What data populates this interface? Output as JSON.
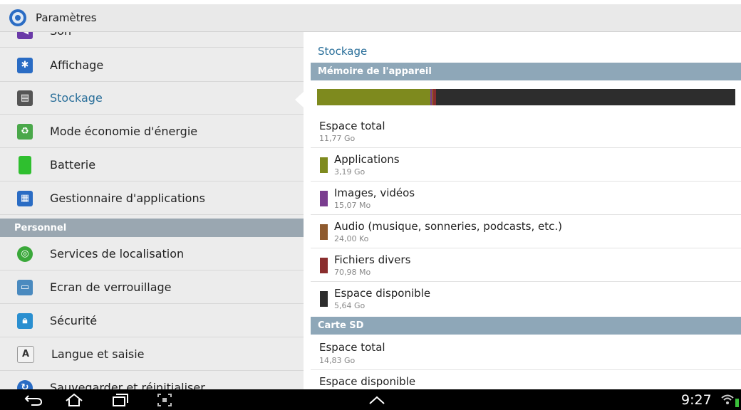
{
  "app": {
    "title": "Paramètres"
  },
  "sidebar": {
    "items_top": [
      {
        "label": "Son",
        "icon": "sound-icon",
        "color": "#6a3aa8"
      },
      {
        "label": "Affichage",
        "icon": "display-icon",
        "color": "#2a6cc4"
      },
      {
        "label": "Stockage",
        "icon": "storage-icon",
        "color": "#555555",
        "selected": true
      },
      {
        "label": "Mode économie d'énergie",
        "icon": "power-saving-icon",
        "color": "#4aa84a"
      },
      {
        "label": "Batterie",
        "icon": "battery-icon",
        "color": "#2fbf2f"
      },
      {
        "label": "Gestionnaire d'applications",
        "icon": "app-manager-icon",
        "color": "#2a6cc4"
      }
    ],
    "section_personal": "Personnel",
    "items_personal": [
      {
        "label": "Services de localisation",
        "icon": "location-icon",
        "color": "#3aa83a"
      },
      {
        "label": "Ecran de verrouillage",
        "icon": "lock-screen-icon",
        "color": "#4a8abf"
      },
      {
        "label": "Sécurité",
        "icon": "security-lock-icon",
        "color": "#2a8fd0"
      },
      {
        "label": "Langue et saisie",
        "icon": "keyboard-icon",
        "color": "#e0e0e0"
      },
      {
        "label": "Sauvegarder et réinitialiser",
        "icon": "backup-icon",
        "color": "#2a6cc4"
      }
    ]
  },
  "storage": {
    "title": "Stockage",
    "device_section": "Mémoire de l'appareil",
    "usage_bar": [
      {
        "name": "Applications",
        "fraction": 0.271,
        "color": "#7e8a1e"
      },
      {
        "name": "Images, vidéos",
        "fraction": 0.003,
        "color": "#7a3d8f"
      },
      {
        "name": "Audio",
        "fraction": 0.002,
        "color": "#8e5a2e"
      },
      {
        "name": "Fichiers divers",
        "fraction": 0.006,
        "color": "#8a2e2e"
      },
      {
        "name": "Espace disponible",
        "fraction": 0.718,
        "color": "#2d2d2d"
      }
    ],
    "total_label": "Espace total",
    "total_value": "11,77 Go",
    "categories": [
      {
        "label": "Applications",
        "value": "3,19 Go",
        "color": "#7e8a1e"
      },
      {
        "label": "Images, vidéos",
        "value": "15,07 Mo",
        "color": "#7a3d8f"
      },
      {
        "label": "Audio (musique, sonneries, podcasts, etc.)",
        "value": "24,00 Ko",
        "color": "#8e5a2e"
      },
      {
        "label": "Fichiers divers",
        "value": "70,98 Mo",
        "color": "#8a2e2e"
      },
      {
        "label": "Espace disponible",
        "value": "5,64 Go",
        "color": "#2d2d2d"
      }
    ],
    "sd_section": "Carte SD",
    "sd_total_label": "Espace total",
    "sd_total_value": "14,83 Go",
    "sd_free_label": "Espace disponible"
  },
  "navbar": {
    "time": "9:27",
    "icons": [
      "back-icon",
      "home-icon",
      "recent-apps-icon",
      "screenshot-icon",
      "up-chevron-icon",
      "wifi-icon"
    ]
  }
}
